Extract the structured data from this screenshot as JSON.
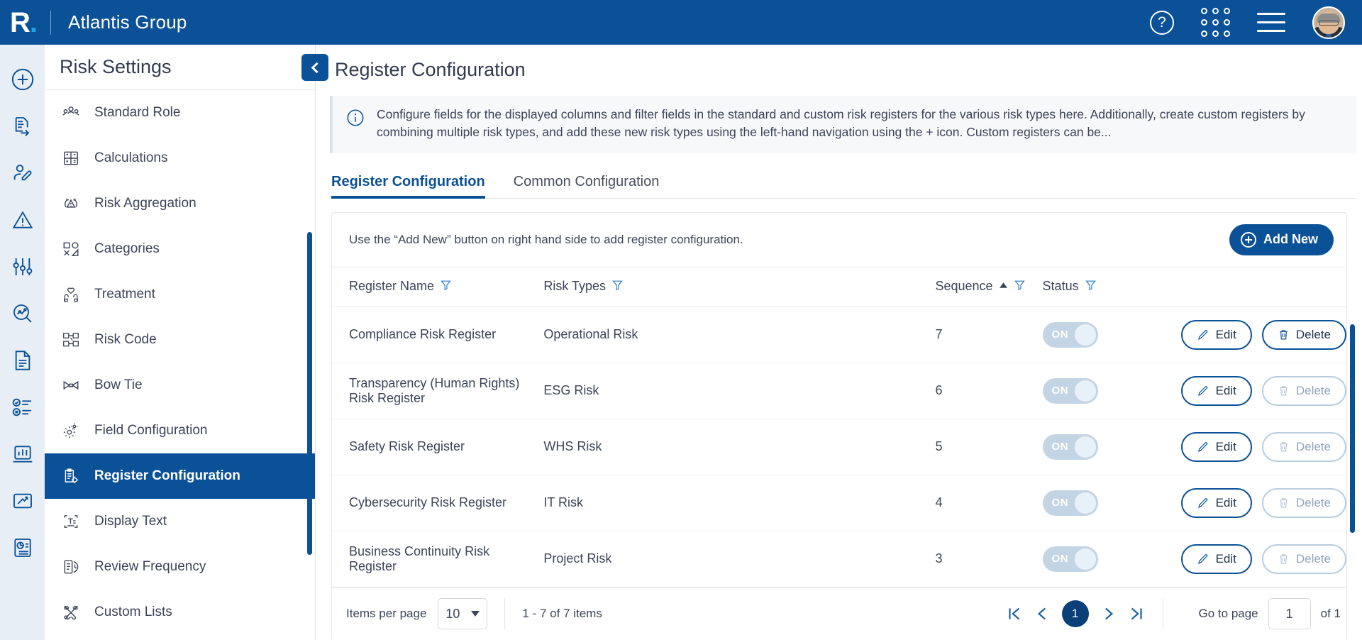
{
  "topbar": {
    "logo_letter": "R",
    "logo_dot": ".",
    "org_title": "Atlantis Group",
    "help_glyph": "?",
    "icons": [
      "help-icon",
      "apps-grid-icon",
      "menu-icon",
      "avatar"
    ]
  },
  "rail": {
    "items": [
      {
        "name": "add-icon"
      },
      {
        "name": "document-export-icon"
      },
      {
        "name": "user-edit-icon"
      },
      {
        "name": "risk-warning-icon"
      },
      {
        "name": "sliders-icon"
      },
      {
        "name": "analytics-search-icon"
      },
      {
        "name": "document-icon"
      },
      {
        "name": "checklist-icon"
      },
      {
        "name": "dashboard-chart-icon"
      },
      {
        "name": "trend-up-icon"
      },
      {
        "name": "report-icon"
      }
    ]
  },
  "sidebar": {
    "title": "Risk Settings",
    "collapse_label": "",
    "items": [
      {
        "label": "Standard Role",
        "icon": "people-icon",
        "active": false
      },
      {
        "label": "Calculations",
        "icon": "calculator-icon",
        "active": false
      },
      {
        "label": "Risk Aggregation",
        "icon": "risk-aggregation-icon",
        "active": false
      },
      {
        "label": "Categories",
        "icon": "shapes-icon",
        "active": false
      },
      {
        "label": "Treatment",
        "icon": "hands-care-icon",
        "active": false
      },
      {
        "label": "Risk Code",
        "icon": "risk-code-icon",
        "active": false
      },
      {
        "label": "Bow Tie",
        "icon": "bow-tie-icon",
        "active": false
      },
      {
        "label": "Field Configuration",
        "icon": "gears-icon",
        "active": false
      },
      {
        "label": "Register Configuration",
        "icon": "clipboard-gear-icon",
        "active": true
      },
      {
        "label": "Display Text",
        "icon": "text-display-icon",
        "active": false
      },
      {
        "label": "Review Frequency",
        "icon": "document-clock-icon",
        "active": false
      },
      {
        "label": "Custom Lists",
        "icon": "tools-icon",
        "active": false
      }
    ]
  },
  "main": {
    "page_title": "Register Configuration",
    "info_text": "Configure fields for the displayed columns and filter fields in the standard and custom risk registers for the various risk types here. Additionally, create custom registers by combining multiple risk types, and add these new risk types using the left-hand navigation using the + icon. Custom registers can be...",
    "tabs": [
      {
        "label": "Register Configuration",
        "active": true
      },
      {
        "label": "Common Configuration",
        "active": false
      }
    ],
    "card_hint": "Use the “Add New” button on right hand side to add register configuration.",
    "add_new_label": "Add New",
    "table": {
      "columns": [
        {
          "label": "Register Name",
          "filter": true,
          "sort": null
        },
        {
          "label": "Risk Types",
          "filter": true,
          "sort": null
        },
        {
          "label": "Sequence",
          "filter": true,
          "sort": "asc"
        },
        {
          "label": "Status",
          "filter": true,
          "sort": null
        },
        {
          "label": "",
          "filter": false,
          "sort": null
        }
      ],
      "rows": [
        {
          "name": "Compliance Risk Register",
          "risk_type": "Operational Risk",
          "sequence": "7",
          "status": "ON",
          "edit_label": "Edit",
          "delete_label": "Delete",
          "delete_enabled": true
        },
        {
          "name": "Transparency (Human Rights) Risk Register",
          "risk_type": "ESG Risk",
          "sequence": "6",
          "status": "ON",
          "edit_label": "Edit",
          "delete_label": "Delete",
          "delete_enabled": false
        },
        {
          "name": "Safety Risk Register",
          "risk_type": "WHS Risk",
          "sequence": "5",
          "status": "ON",
          "edit_label": "Edit",
          "delete_label": "Delete",
          "delete_enabled": false
        },
        {
          "name": "Cybersecurity Risk Register",
          "risk_type": "IT Risk",
          "sequence": "4",
          "status": "ON",
          "edit_label": "Edit",
          "delete_label": "Delete",
          "delete_enabled": false
        },
        {
          "name": "Business Continuity Risk Register",
          "risk_type": "Project Risk",
          "sequence": "3",
          "status": "ON",
          "edit_label": "Edit",
          "delete_label": "Delete",
          "delete_enabled": false
        }
      ]
    },
    "pager": {
      "items_per_page_label": "Items per page",
      "items_per_page_value": "10",
      "range_text": "1 - 7 of 7 items",
      "current_page": "1",
      "goto_label": "Go to page",
      "goto_value": "1",
      "of_label": "of 1"
    }
  },
  "colors": {
    "brand_blue": "#0a5197",
    "accent_cyan": "#1fa5e0",
    "rail_bg": "#e8eef6",
    "text_dark": "#3d4459",
    "toggle_off": "#c3d4e5"
  }
}
